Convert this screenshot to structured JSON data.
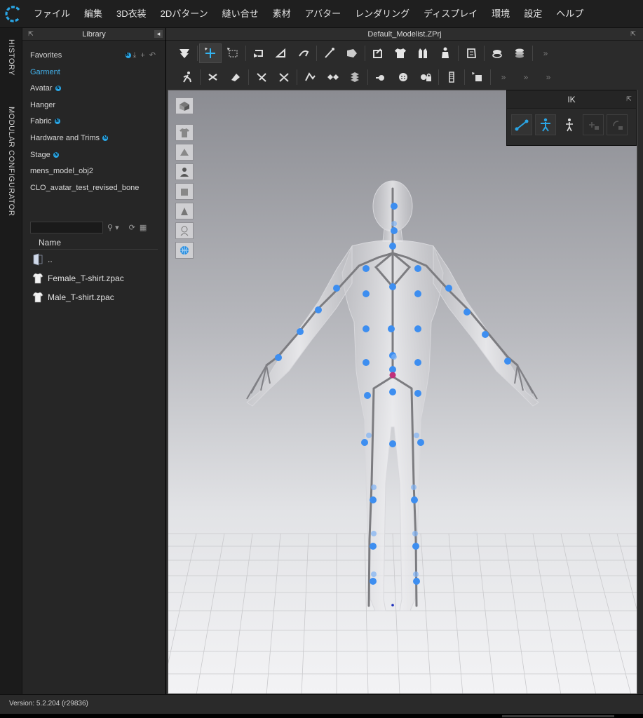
{
  "menubar": {
    "items": [
      "ファイル",
      "編集",
      "3D衣装",
      "2Dパターン",
      "縫い合せ",
      "素材",
      "アバター",
      "レンダリング",
      "ディスプレイ",
      "環境",
      "設定",
      "ヘルプ"
    ]
  },
  "sidetabs": {
    "history": "HISTORY",
    "modular": "MODULAR CONFIGURATOR"
  },
  "library": {
    "title": "Library",
    "items": [
      {
        "label": "Favorites",
        "badge": "N"
      },
      {
        "label": "Garment"
      },
      {
        "label": "Avatar",
        "badge": "N"
      },
      {
        "label": "Hanger"
      },
      {
        "label": "Fabric",
        "badge": "N"
      },
      {
        "label": "Hardware and Trims",
        "badge": "N"
      },
      {
        "label": "Stage",
        "badge": "N"
      },
      {
        "label": "mens_model_obj2"
      },
      {
        "label": "CLO_avatar_test_revised_bone"
      }
    ],
    "search": {
      "value": "",
      "placeholder": ""
    },
    "file_header": "Name",
    "files": [
      {
        "label": "..",
        "icon": "folder-up-icon"
      },
      {
        "label": "Female_T-shirt.zpac",
        "icon": "tshirt-icon"
      },
      {
        "label": "Male_T-shirt.zpac",
        "icon": "tshirt-icon"
      }
    ]
  },
  "project": {
    "title": "Default_Modelist.ZPrj"
  },
  "ik": {
    "title": "IK"
  },
  "status": {
    "version": "Version: 5.2.204 (r29836)"
  },
  "colors": {
    "accent": "#43b2ec",
    "joint": "#3d8ef0",
    "root_joint": "#c0307a"
  }
}
